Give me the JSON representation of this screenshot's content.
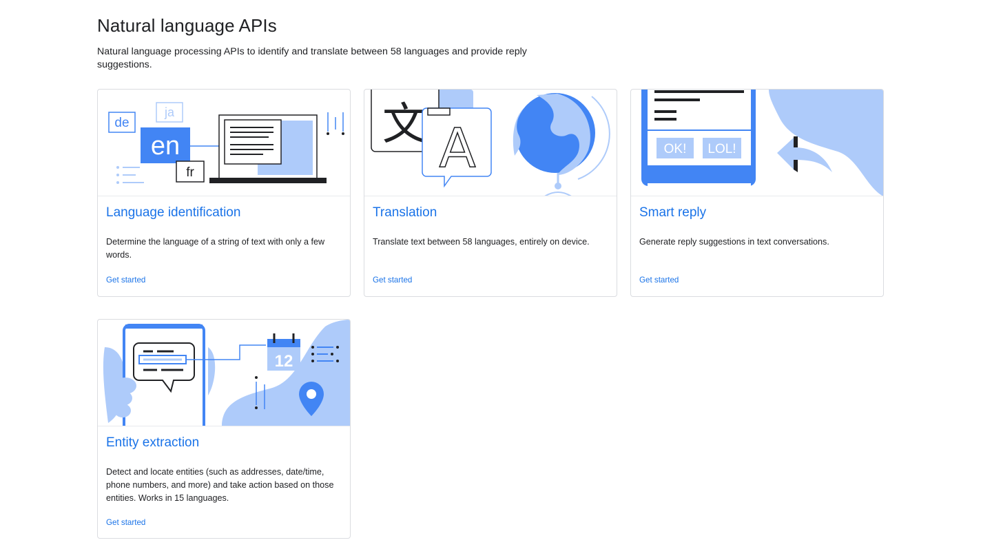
{
  "header": {
    "title": "Natural language APIs",
    "description": "Natural language processing APIs to identify and translate between 58 languages and provide reply suggestions."
  },
  "colors": {
    "accent": "#1a73e8",
    "illustration_blue": "#4285f4",
    "illustration_light_blue": "#aecbfa",
    "ink": "#202124"
  },
  "cards": [
    {
      "title": "Language identification",
      "description": "Determine the language of a string of text with only a few words.",
      "link": "Get started",
      "illustration": {
        "icon": "language-identification-illustration",
        "labels": {
          "de": "de",
          "ja": "ja",
          "en": "en",
          "fr": "fr"
        }
      }
    },
    {
      "title": "Translation",
      "description": "Translate text between 58 languages, entirely on device.",
      "link": "Get started",
      "illustration": {
        "icon": "translation-illustration",
        "labels": {
          "glyph": "文",
          "letter": "A"
        }
      }
    },
    {
      "title": "Smart reply",
      "description": "Generate reply suggestions in text conversations.",
      "link": "Get started",
      "illustration": {
        "icon": "smart-reply-illustration",
        "labels": {
          "reply_1": "OK!",
          "reply_2": "LOL!"
        }
      }
    },
    {
      "title": "Entity extraction",
      "description": "Detect and locate entities (such as addresses, date/time, phone numbers, and more) and take action based on those entities. Works in 15 languages.",
      "link": "Get started",
      "illustration": {
        "icon": "entity-extraction-illustration",
        "labels": {
          "calendar_day": "12"
        }
      }
    }
  ]
}
